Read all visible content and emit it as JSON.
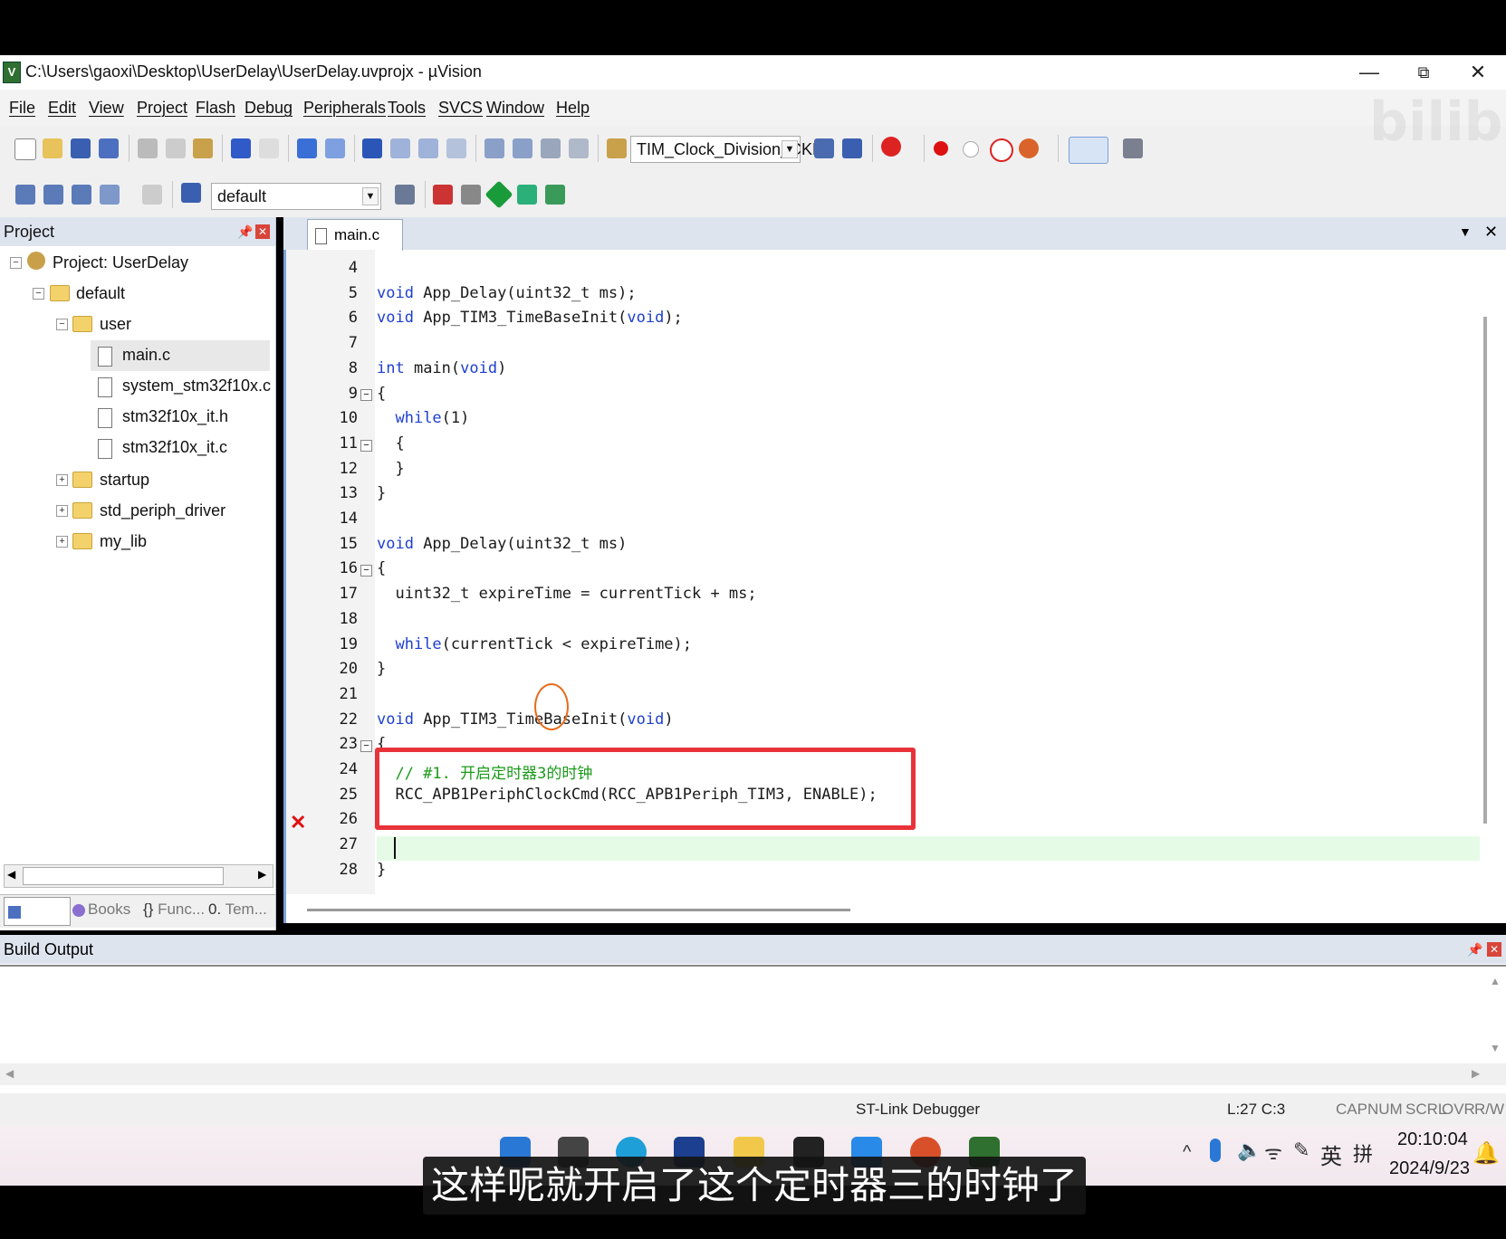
{
  "window": {
    "title": "C:\\Users\\gaoxi\\Desktop\\UserDelay\\UserDelay.uvprojx - µVision",
    "minimize": "—",
    "maximize": "⧉",
    "close": "✕"
  },
  "menu": [
    "File",
    "Edit",
    "View",
    "Project",
    "Flash",
    "Debug",
    "Peripherals",
    "Tools",
    "SVCS",
    "Window",
    "Help"
  ],
  "toolbar": {
    "target_combo": "TIM_Clock_Division_CKD",
    "build_target": "default"
  },
  "project_panel": {
    "title": "Project",
    "pin": "📌",
    "close": "✕",
    "tree": {
      "root": "Project: UserDelay",
      "target": "default",
      "group_user": "user",
      "files": [
        "main.c",
        "system_stm32f10x.c",
        "stm32f10x_it.h",
        "stm32f10x_it.c"
      ],
      "groups": [
        "startup",
        "std_periph_driver",
        "my_lib"
      ]
    },
    "tabs": [
      "Project",
      "Books",
      "Func...",
      "Tem..."
    ]
  },
  "editor": {
    "tab": "main.c",
    "lines": [
      {
        "n": "4",
        "html": ""
      },
      {
        "n": "5",
        "html": "void App_Delay(uint32_t ms);"
      },
      {
        "n": "6",
        "html": "void App_TIM3_TimeBaseInit(void);"
      },
      {
        "n": "7",
        "html": ""
      },
      {
        "n": "8",
        "html": "int main(void)"
      },
      {
        "n": "9",
        "html": "{"
      },
      {
        "n": "10",
        "html": "  while(1)"
      },
      {
        "n": "11",
        "html": "  {"
      },
      {
        "n": "12",
        "html": "  }"
      },
      {
        "n": "13",
        "html": "}"
      },
      {
        "n": "14",
        "html": ""
      },
      {
        "n": "15",
        "html": "void App_Delay(uint32_t ms)"
      },
      {
        "n": "16",
        "html": "{"
      },
      {
        "n": "17",
        "html": "  uint32_t expireTime = currentTick + ms;"
      },
      {
        "n": "18",
        "html": ""
      },
      {
        "n": "19",
        "html": "  while(currentTick < expireTime);"
      },
      {
        "n": "20",
        "html": "}"
      },
      {
        "n": "21",
        "html": ""
      },
      {
        "n": "22",
        "html": "void App_TIM3_TimeBaseInit(void)"
      },
      {
        "n": "23",
        "html": "{"
      },
      {
        "n": "24",
        "html": "  // #1. 开启定时器3的时钟"
      },
      {
        "n": "25",
        "html": "  RCC_APB1PeriphClockCmd(RCC_APB1Periph_TIM3, ENABLE);"
      },
      {
        "n": "26",
        "html": ""
      },
      {
        "n": "27",
        "html": "  "
      },
      {
        "n": "28",
        "html": "}"
      }
    ],
    "error_marker": "✕"
  },
  "build_output": {
    "title": "Build Output"
  },
  "statusbar": {
    "debugger": "ST-Link Debugger",
    "position": "L:27 C:3",
    "indicators": [
      "CAP",
      "NUM",
      "SCRL",
      "OVR",
      "R/W"
    ]
  },
  "taskbar": {
    "ime": "英",
    "ime2": "拼",
    "time": "20:10:04",
    "date": "2024/9/23"
  },
  "subtitle": "这样呢就开启了这个定时器三的时钟了",
  "watermark": "bilibili"
}
